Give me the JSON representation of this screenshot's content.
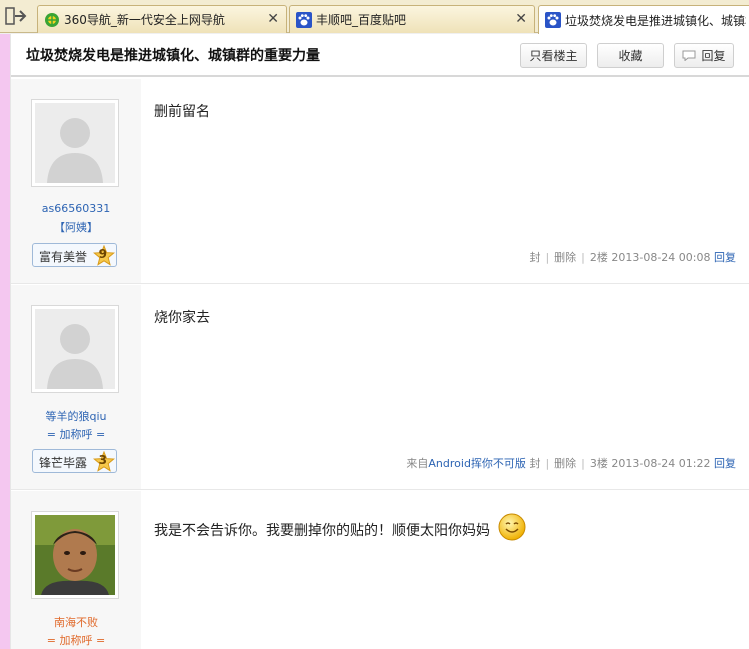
{
  "tabs": [
    {
      "title": "360导航_新一代安全上网导航",
      "favicon": "360-icon",
      "active": false
    },
    {
      "title": "丰顺吧_百度贴吧",
      "favicon": "baidu-paw-icon",
      "active": false
    },
    {
      "title": "垃圾焚烧发电是推进城镇化、城镇群",
      "favicon": "baidu-paw-icon",
      "active": true
    }
  ],
  "thread": {
    "title": "垃圾焚烧发电是推进城镇化、城镇群的重要力量",
    "btn_owner_only": "只看楼主",
    "btn_favorite": "收藏",
    "btn_reply": "回复"
  },
  "posts": [
    {
      "username": "as66560331",
      "user_title": "【阿姨】",
      "badge_name": "富有美誉",
      "badge_level": "9",
      "content": "删前留名",
      "ban": "封",
      "delete": "删除",
      "floor": "2楼",
      "time": "2013-08-24 00:08",
      "reply": "回复"
    },
    {
      "username": "等羊的狼qiu",
      "user_title": "= 加称呼 =",
      "badge_name": "锋芒毕露",
      "badge_level": "3",
      "content": "烧你家去",
      "device_prefix": "来自",
      "device": "Android",
      "device_suffix": "挥你不可版",
      "ban": "封",
      "delete": "删除",
      "floor": "3楼",
      "time": "2013-08-24 01:22",
      "reply": "回复"
    },
    {
      "username": "南海不败",
      "user_title": "= 加称呼 =",
      "content": "我是不会告诉你。我要删掉你的贴的！顺便太阳你妈妈"
    }
  ]
}
